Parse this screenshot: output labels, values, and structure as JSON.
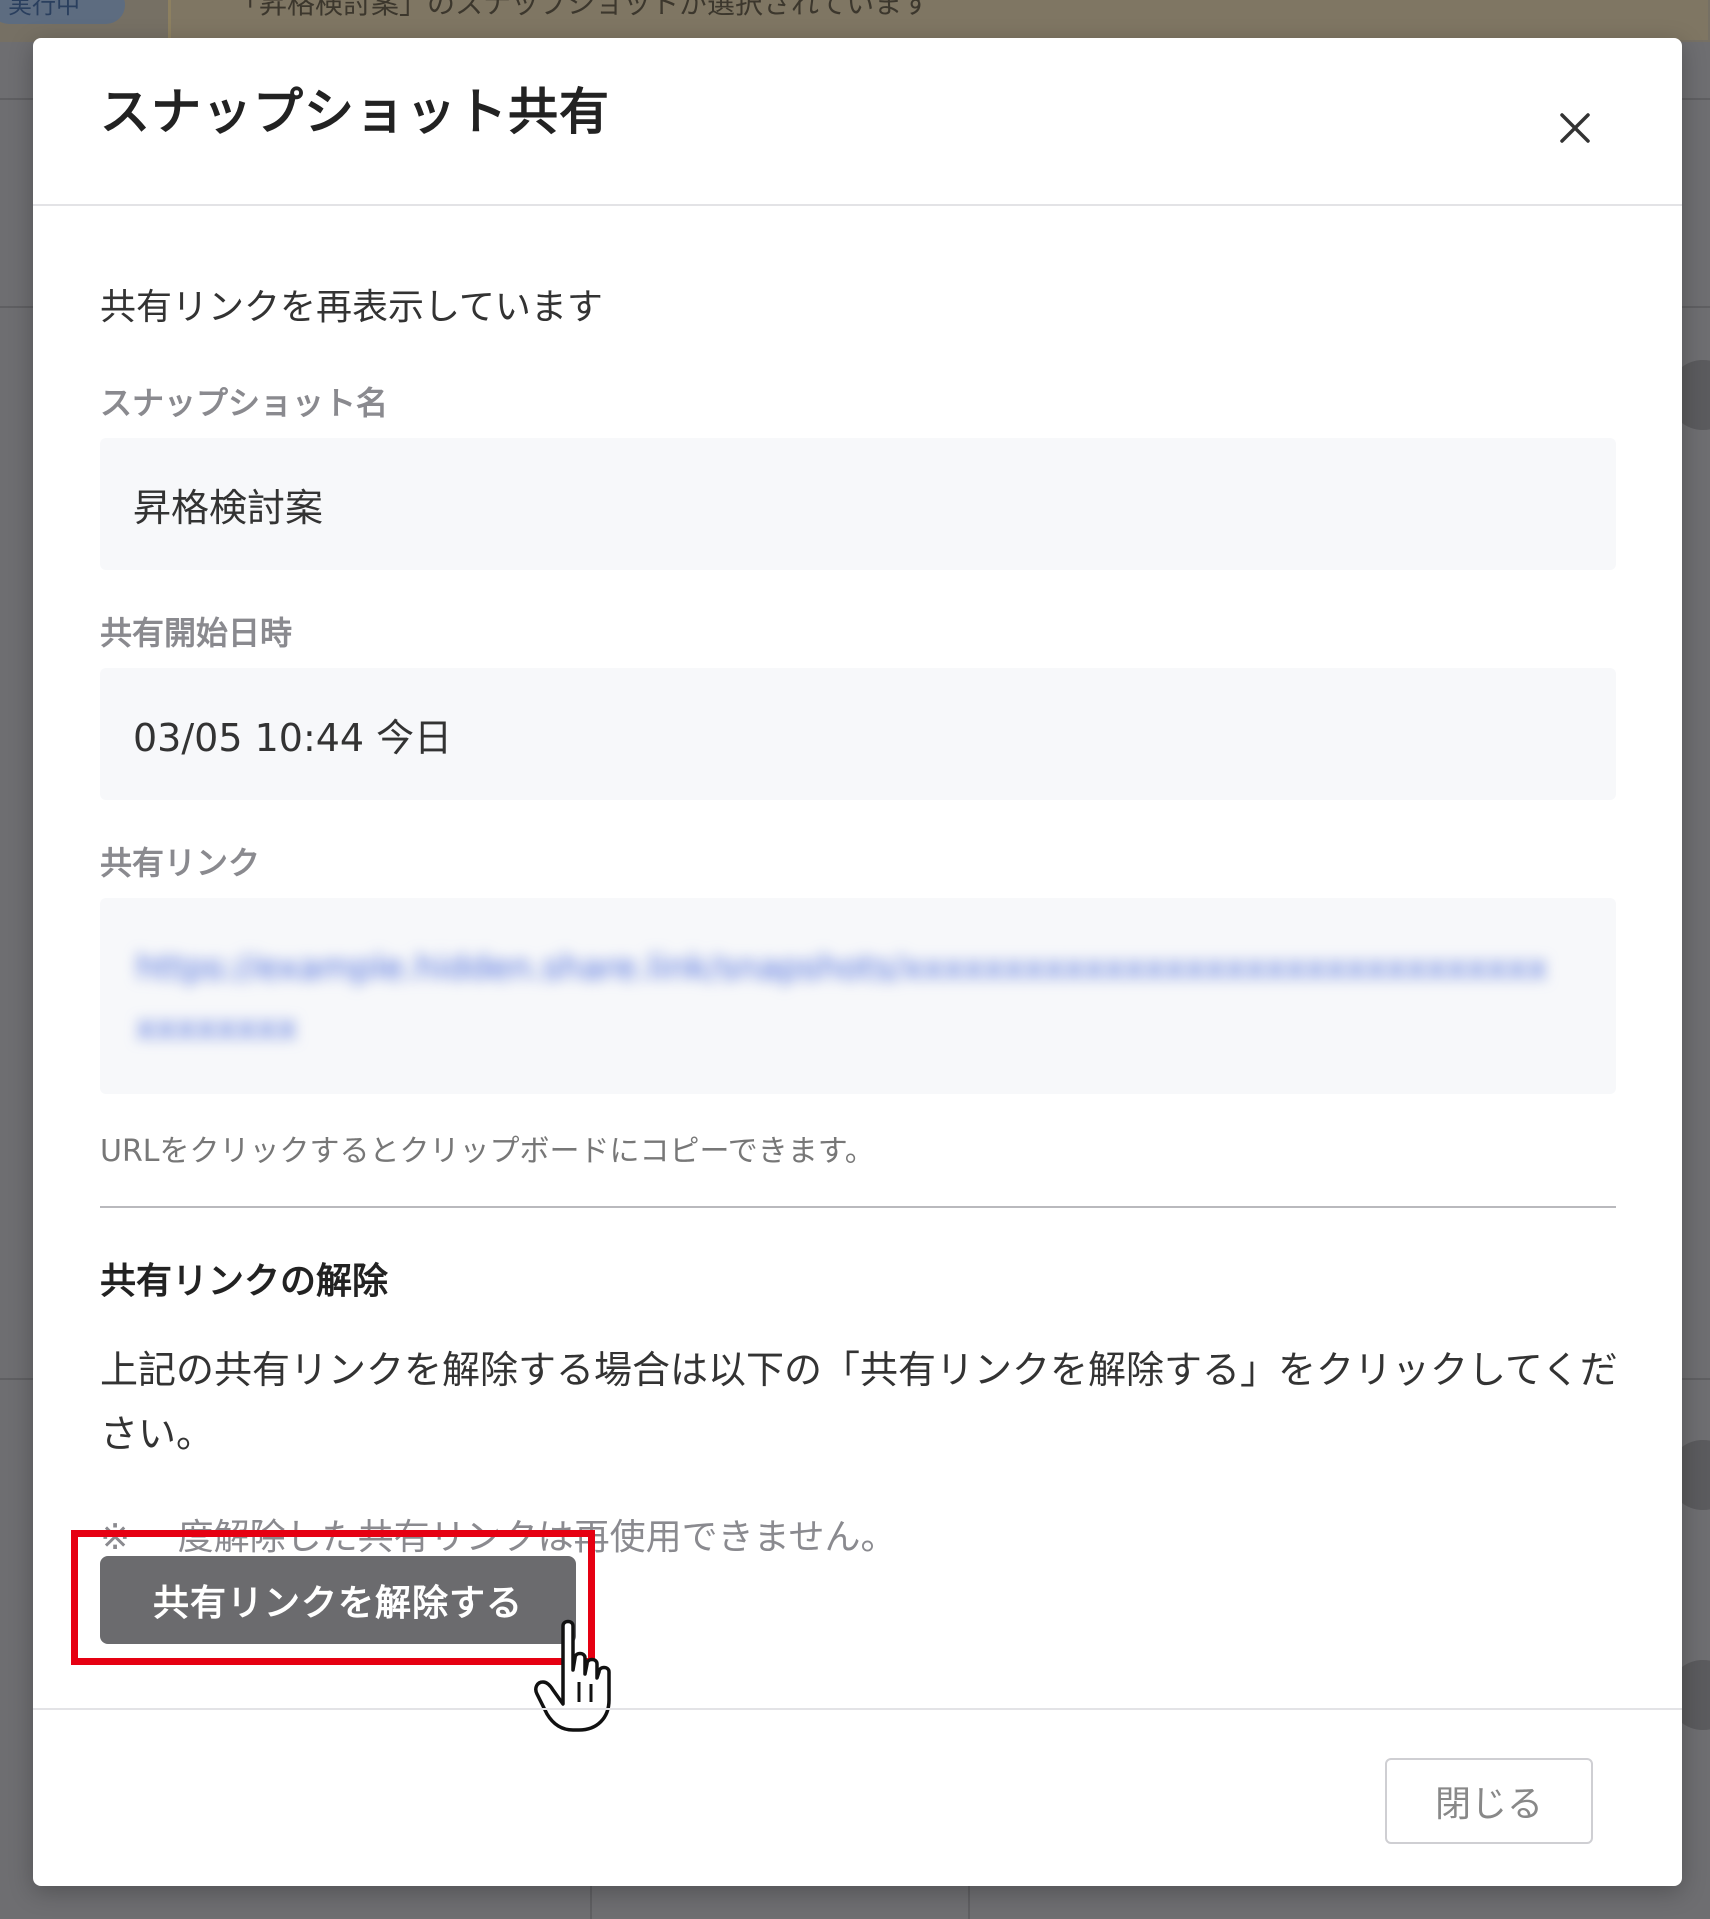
{
  "background": {
    "status_badge": "実行中",
    "notice_text": "「昇格検討案」のスナップショットが選択されています"
  },
  "modal": {
    "title": "スナップショット共有",
    "intro": "共有リンクを再表示しています",
    "fields": {
      "snapshot_name": {
        "label": "スナップショット名",
        "value": "昇格検討案"
      },
      "start_datetime": {
        "label": "共有開始日時",
        "value": "03/05 10:44 今日"
      },
      "share_link": {
        "label": "共有リンク",
        "value": "https://example.hidden.share.link/snapshots/xxxxxxxxxxxxxxxxxxxxxxxxxxxxxxxxxxxxxxxx",
        "hint": "URLをクリックするとクリップボードにコピーできます。"
      }
    },
    "revoke": {
      "title": "共有リンクの解除",
      "description": "上記の共有リンクを解除する場合は以下の「共有リンクを解除する」をクリックしてください。",
      "note": "※ 一度解除した共有リンクは再使用できません。",
      "button_label": "共有リンクを解除する"
    },
    "footer": {
      "close_label": "閉じる"
    }
  },
  "colors": {
    "highlight": "#e60012",
    "revoke_button": "#6b6b6e",
    "link": "#4a6bdc"
  }
}
